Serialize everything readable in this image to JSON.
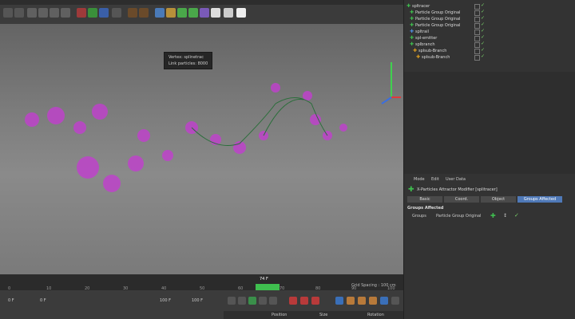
{
  "tooltip": {
    "line1": "Vertex: splinetrac",
    "line2": "Link particles: 8000"
  },
  "objects": [
    {
      "name": "spltracer",
      "icon_color": "#3fbf4f"
    },
    {
      "name": "Particle Group Original",
      "icon_color": "#3fbf4f"
    },
    {
      "name": "Particle Group Original",
      "icon_color": "#3fbf4f"
    },
    {
      "name": "Particle Group Original",
      "icon_color": "#3fbf4f"
    },
    {
      "name": "spltrail",
      "icon_color": "#4f8fe0"
    },
    {
      "name": "spl-emitter",
      "icon_color": "#3fbf4f"
    },
    {
      "name": "splbranch",
      "icon_color": "#3fbf4f"
    },
    {
      "name": "splsub-Branch",
      "icon_color": "#e0a020"
    },
    {
      "name": "splsub-Branch",
      "icon_color": "#e0a020"
    }
  ],
  "attributes": {
    "menu": [
      "Mode",
      "Edit",
      "User Data"
    ],
    "title": "X-Particles Attractor Modifier [splitracer]",
    "tabs": [
      "Basic",
      "Coord.",
      "Object",
      "Groups Affected"
    ],
    "active_tab": "Groups Affected",
    "section": "Groups Affected",
    "groups_label": "Groups",
    "group_value": "Particle Group Original"
  },
  "timeline": {
    "ticks": [
      "0",
      "10",
      "20",
      "30",
      "40",
      "50",
      "60",
      "70",
      "80",
      "90",
      "100"
    ],
    "current": "74 F"
  },
  "viewport": {
    "grid_spacing": "Grid Spacing : 100 cm"
  },
  "transport": {
    "frame_start": "0 F",
    "frame_current": "0 F",
    "frame_end": "100 F",
    "frame_max": "100 F"
  },
  "coords": {
    "position": "Position",
    "size": "Size",
    "rotation": "Rotation"
  }
}
